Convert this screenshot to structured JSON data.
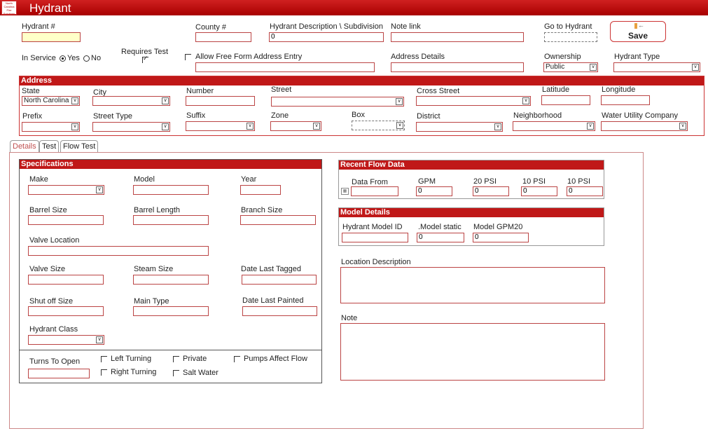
{
  "app": {
    "title": "Hydrant",
    "logo_text": "North Carolina Fire Solutions"
  },
  "top": {
    "hydrant_num_label": "Hydrant #",
    "hydrant_num_value": "",
    "county_label": "County #",
    "description_label": "Hydrant Description \\ Subdivision",
    "description_value": "0",
    "note_link_label": "Note link",
    "go_to_hydrant_label": "Go to Hydrant",
    "save_label": "Save",
    "in_service_label": "In Service",
    "yes_label": "Yes",
    "no_label": "No",
    "requires_test_label": "Requires Test",
    "free_form_label": "Allow Free Form Address Entry",
    "address_details_label": "Address Details",
    "ownership_label": "Ownership",
    "ownership_value": "Public",
    "hydrant_type_label": "Hydrant Type"
  },
  "address": {
    "header": "Address",
    "state_label": "State",
    "state_value": "North Carolina",
    "city_label": "City",
    "number_label": "Number",
    "street_label": "Street",
    "cross_street_label": "Cross Street",
    "latitude_label": "Latitude",
    "longitude_label": "Longitude",
    "prefix_label": "Prefix",
    "street_type_label": "Street Type",
    "suffix_label": "Suffix",
    "zone_label": "Zone",
    "box_label": "Box",
    "district_label": "District",
    "neighborhood_label": "Neighborhood",
    "water_utility_label": "Water Utility Company"
  },
  "tabs": [
    {
      "label": "Details"
    },
    {
      "label": "Test"
    },
    {
      "label": "Flow Test"
    }
  ],
  "specs": {
    "header": "Specifications",
    "make": "Make",
    "model": "Model",
    "year": "Year",
    "barrel_size": "Barrel Size",
    "barrel_length": "Barrel Length",
    "branch_size": "Branch Size",
    "valve_location": "Valve Location",
    "valve_size": "Valve Size",
    "steam_size": "Steam Size",
    "date_last_tagged": "Date Last Tagged",
    "shut_off_size": "Shut off Size",
    "main_type": "Main Type",
    "date_last_painted": "Date Last Painted",
    "hydrant_class": "Hydrant Class",
    "turns_to_open": "Turns To Open",
    "left_turning": "Left Turning",
    "right_turning": "Right Turning",
    "private": "Private",
    "salt_water": "Salt Water",
    "pumps_affect_flow": "Pumps Affect Flow"
  },
  "flow": {
    "header": "Recent Flow Data",
    "data_from": "Data From",
    "gpm": "GPM",
    "psi20": "20 PSI",
    "psi10a": "10 PSI",
    "psi10b": "10 PSI",
    "gpm_value": "0",
    "psi20_value": "0",
    "psi10a_value": "0",
    "psi10b_value": "0"
  },
  "model_details": {
    "header": "Model Details",
    "model_id": "Hydrant Model ID",
    "model_static": ".Model static",
    "model_gpm20": "Model GPM20",
    "model_static_value": "0",
    "model_gpm20_value": "0"
  },
  "location_description_label": "Location Description",
  "note_label": "Note"
}
